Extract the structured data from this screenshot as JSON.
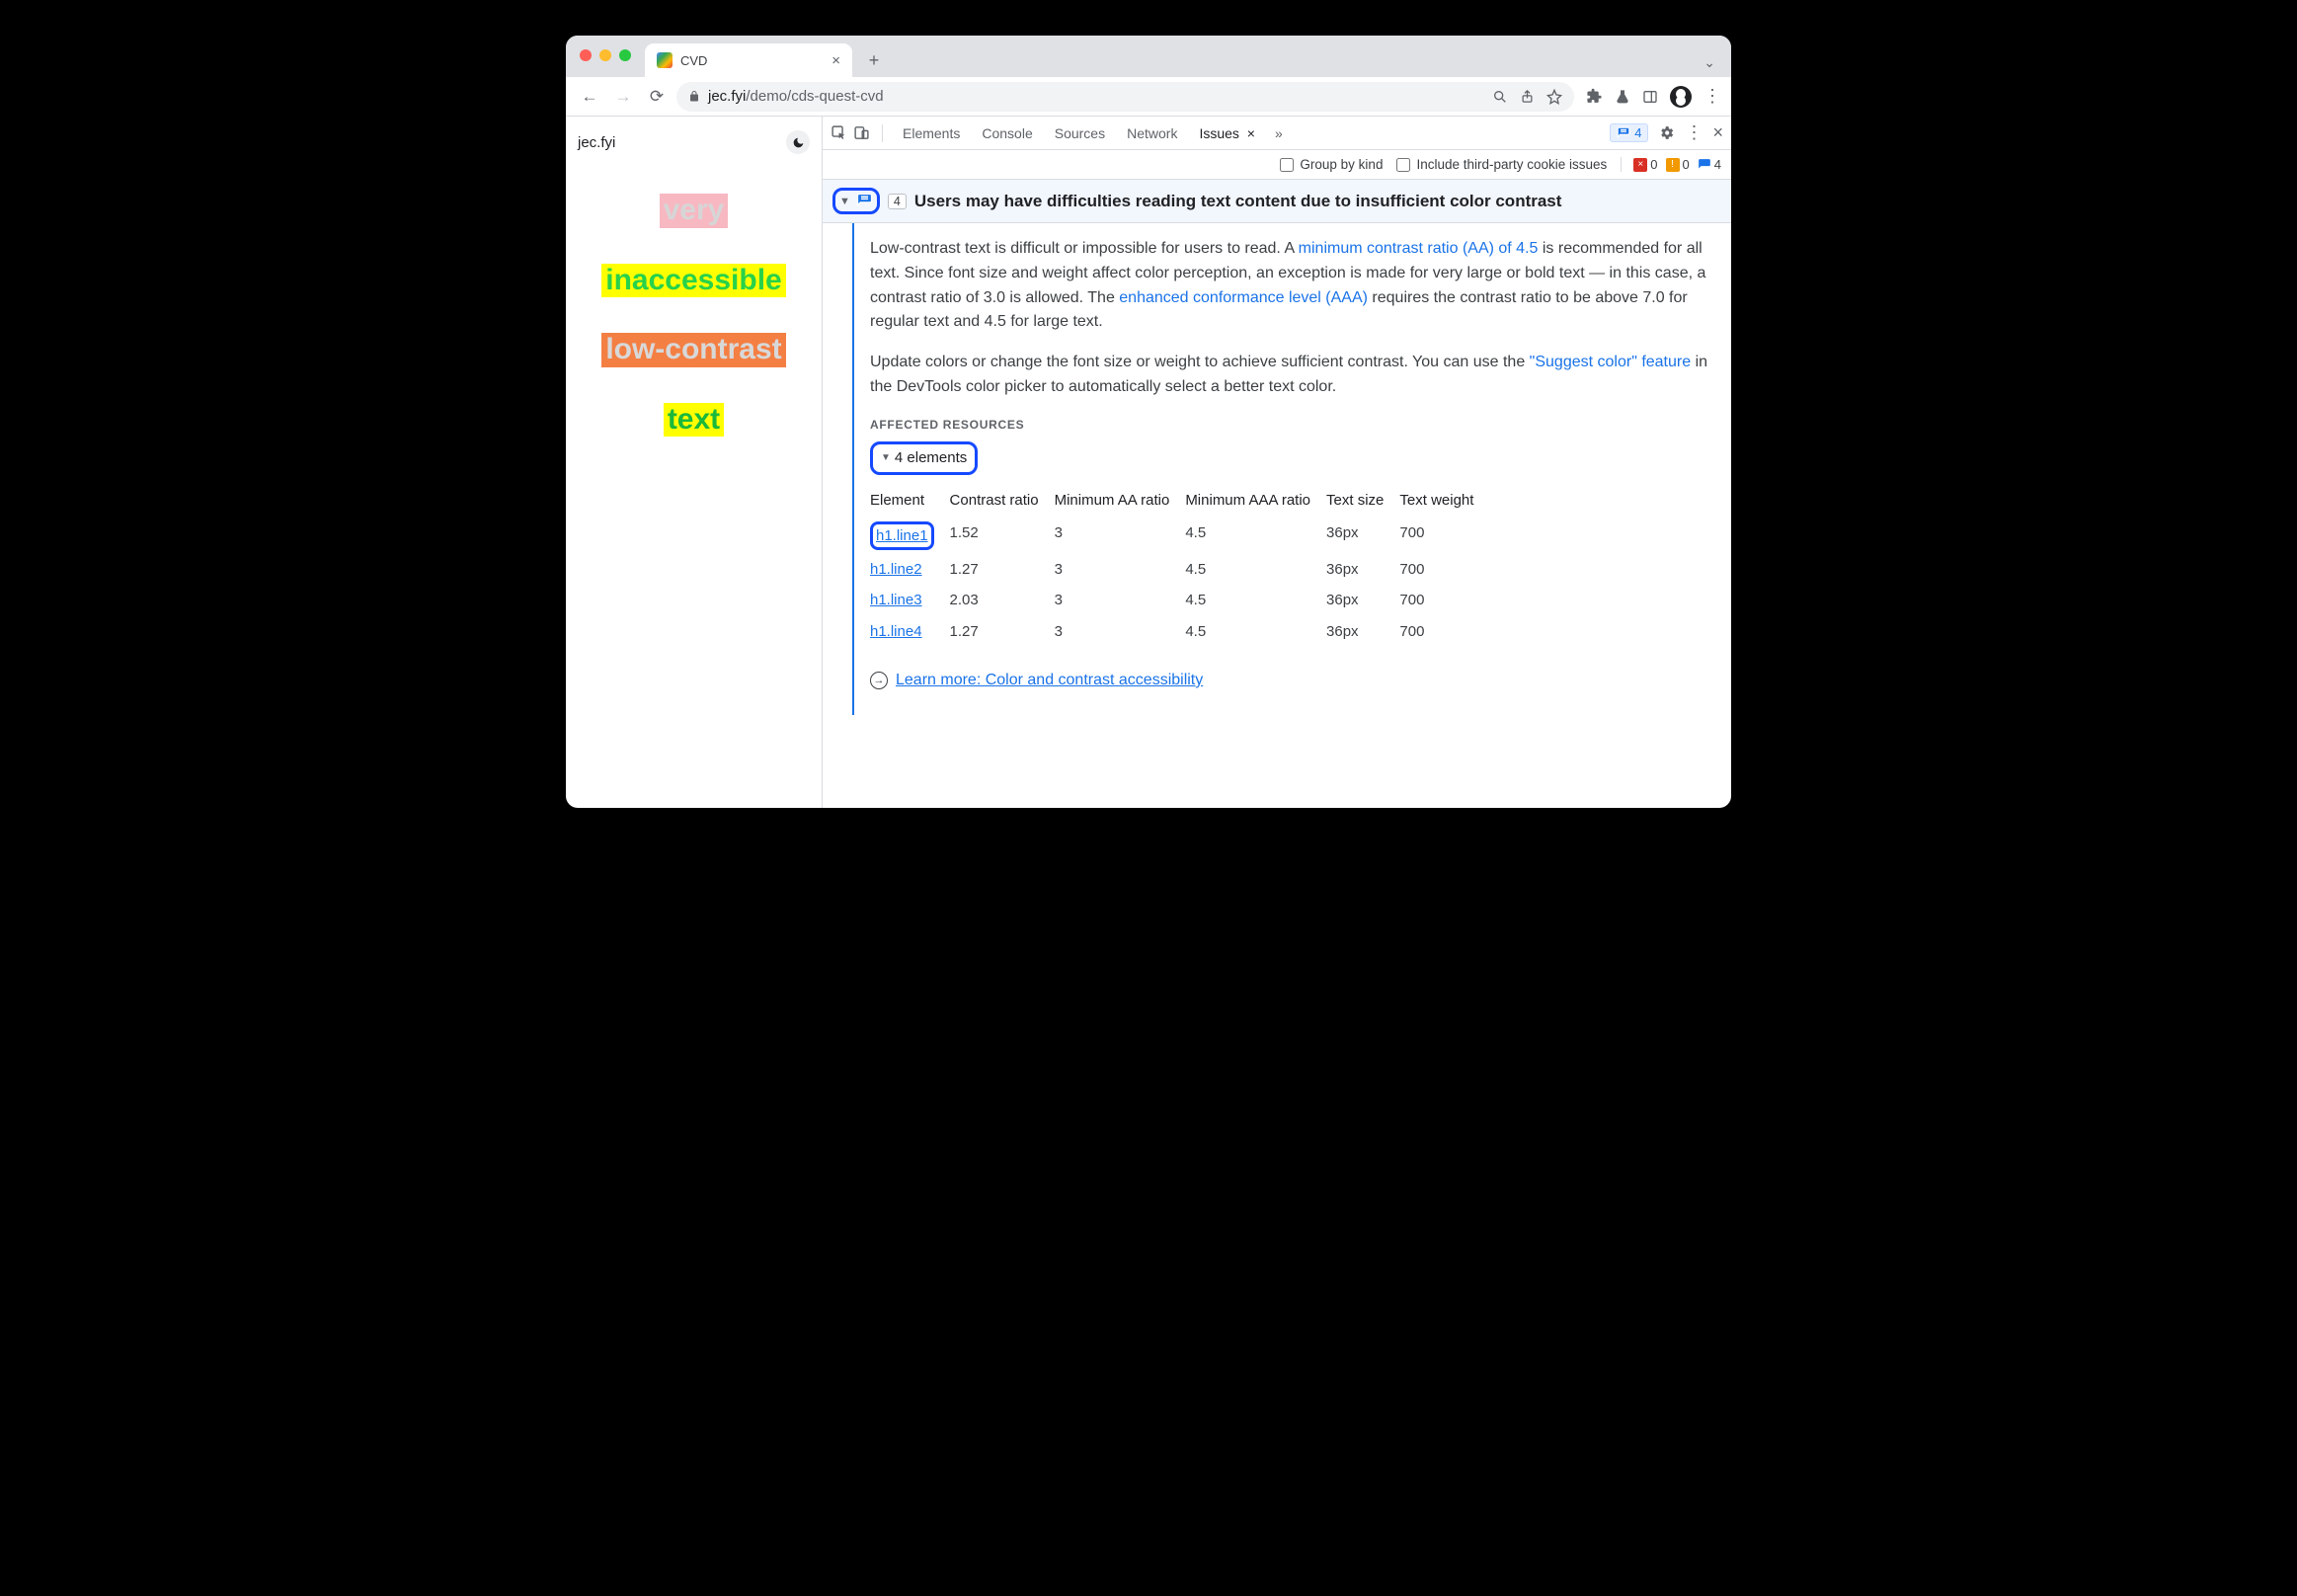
{
  "window": {
    "tab_title": "CVD",
    "url_host": "jec.fyi",
    "url_path": "/demo/cds-quest-cvd"
  },
  "page": {
    "site_label": "jec.fyi",
    "swatches": [
      "very",
      "inaccessible",
      "low-contrast",
      "text"
    ]
  },
  "devtools": {
    "tabs": [
      "Elements",
      "Console",
      "Sources",
      "Network",
      "Issues"
    ],
    "active_tab": "Issues",
    "issues_badge": 4,
    "group_by_kind_label": "Group by kind",
    "include_third_party_label": "Include third-party cookie issues",
    "counts": {
      "errors": 0,
      "warnings": 0,
      "messages": 4
    }
  },
  "issue": {
    "count": 4,
    "title": "Users may have difficulties reading text content due to insufficient color contrast",
    "para1_a": "Low-contrast text is difficult or impossible for users to read. A ",
    "link1": "minimum contrast ratio (AA) of 4.5",
    "para1_b": " is recommended for all text. Since font size and weight affect color perception, an exception is made for very large or bold text — in this case, a contrast ratio of 3.0 is allowed. The ",
    "link2": "enhanced conformance level (AAA)",
    "para1_c": " requires the contrast ratio to be above 7.0 for regular text and 4.5 for large text.",
    "para2_a": "Update colors or change the font size or weight to achieve sufficient contrast. You can use the ",
    "link3": "\"Suggest color\" feature",
    "para2_b": " in the DevTools color picker to automatically select a better text color.",
    "affected_label": "AFFECTED RESOURCES",
    "elements_summary": "4 elements",
    "columns": [
      "Element",
      "Contrast ratio",
      "Minimum AA ratio",
      "Minimum AAA ratio",
      "Text size",
      "Text weight"
    ],
    "rows": [
      {
        "el": "h1.line1",
        "cr": "1.52",
        "aa": "3",
        "aaa": "4.5",
        "size": "36px",
        "weight": "700"
      },
      {
        "el": "h1.line2",
        "cr": "1.27",
        "aa": "3",
        "aaa": "4.5",
        "size": "36px",
        "weight": "700"
      },
      {
        "el": "h1.line3",
        "cr": "2.03",
        "aa": "3",
        "aaa": "4.5",
        "size": "36px",
        "weight": "700"
      },
      {
        "el": "h1.line4",
        "cr": "1.27",
        "aa": "3",
        "aaa": "4.5",
        "size": "36px",
        "weight": "700"
      }
    ],
    "learn_more": "Learn more: Color and contrast accessibility"
  }
}
